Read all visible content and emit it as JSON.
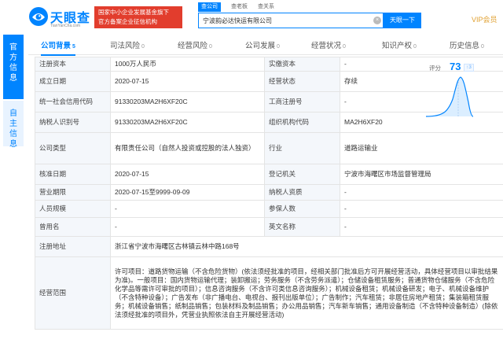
{
  "header": {
    "logo_title": "天眼查",
    "logo_sub": "TianYanCha.com",
    "banner_line1": "国家中小企业发展基金旗下",
    "banner_line2": "官方备案企业征信机构",
    "search_tabs": [
      "查公司",
      "查老板",
      "查关系"
    ],
    "search_value": "宁波韵必达快运有限公司",
    "clear_symbol": "×",
    "search_button": "天眼一下",
    "vip": "VIP会员"
  },
  "side_tabs": {
    "active": [
      "官",
      "方",
      "信",
      "息"
    ],
    "inactive": [
      "自",
      "主",
      "信",
      "息"
    ]
  },
  "nav": {
    "items": [
      {
        "label": "公司背景",
        "count": "5"
      },
      {
        "label": "司法风险",
        "count": "0"
      },
      {
        "label": "经营风险",
        "count": "0"
      },
      {
        "label": "公司发展",
        "count": "0"
      },
      {
        "label": "经营状况",
        "count": "0"
      },
      {
        "label": "知识产权",
        "count": "0"
      },
      {
        "label": "历史信息",
        "count": "0"
      }
    ]
  },
  "score": {
    "label": "评分",
    "value": "73",
    "change": "↑3",
    "colors": {
      "line": "#0084ff",
      "fill": "#dbeeff",
      "marker": "#a9c9f0"
    }
  },
  "rows": {
    "r1": {
      "l1": "注册资本",
      "v1": "1000万人民币",
      "l2": "实缴资本",
      "v2": "-"
    },
    "r2": {
      "l1": "成立日期",
      "v1": "2020-07-15",
      "l2": "经营状态",
      "v2": "存续"
    },
    "r3": {
      "l1": "统一社会信用代码",
      "v1": "91330203MA2H6XF20C",
      "l2": "工商注册号",
      "v2": "-"
    },
    "r4": {
      "l1": "纳税人识别号",
      "v1": "91330203MA2H6XF20C",
      "l2": "组织机构代码",
      "v2": "MA2H6XF20"
    },
    "r5": {
      "l1": "公司类型",
      "v1": "有限责任公司（自然人投资或控股的法人独资）",
      "l2": "行业",
      "v2": "道路运输业"
    },
    "r6": {
      "l1": "核准日期",
      "v1": "2020-07-15",
      "l2": "登记机关",
      "v2": "宁波市海曙区市场监督管理局"
    },
    "r7": {
      "l1": "营业期限",
      "v1": "2020-07-15至9999-09-09",
      "l2": "纳税人资质",
      "v2": "-"
    },
    "r8": {
      "l1": "人员规模",
      "v1": "-",
      "l2": "参保人数",
      "v2": "-"
    },
    "r9": {
      "l1": "曾用名",
      "v1": "-",
      "l2": "英文名称",
      "v2": "-"
    },
    "r10": {
      "l1": "注册地址",
      "v1": "浙江省宁波市海曙区古林镇云林中路168号"
    },
    "r11": {
      "l1": "经营范围",
      "v1": "许可项目：道路货物运输（不含危险货物）(依法须经批准的项目，经相关部门批准后方可开展经营活动，具体经营项目以审批结果为准)。一般项目：国内货物运输代理；装卸搬运；劳务服务（不含劳务派遣）；仓储设备租赁服务；普通货物仓储服务（不含危险化学品等需许可审批的项目）；信息咨询服务（不含许可类信息咨询服务）；机械设备租赁；机械设备研发；电子、机械设备维护（不含特种设备）；广告发布（非广播电台、电视台、报刊出版单位）；广告制作；汽车租赁；非居住房地产租赁；集装箱租赁服务；机械设备销售；纸制品销售；包装材料及制品销售；办公用品销售；汽车新车销售；通用设备制造（不含特种设备制造）(除依法须经批准的项目外，凭营业执照依法自主开展经营活动)"
    }
  }
}
